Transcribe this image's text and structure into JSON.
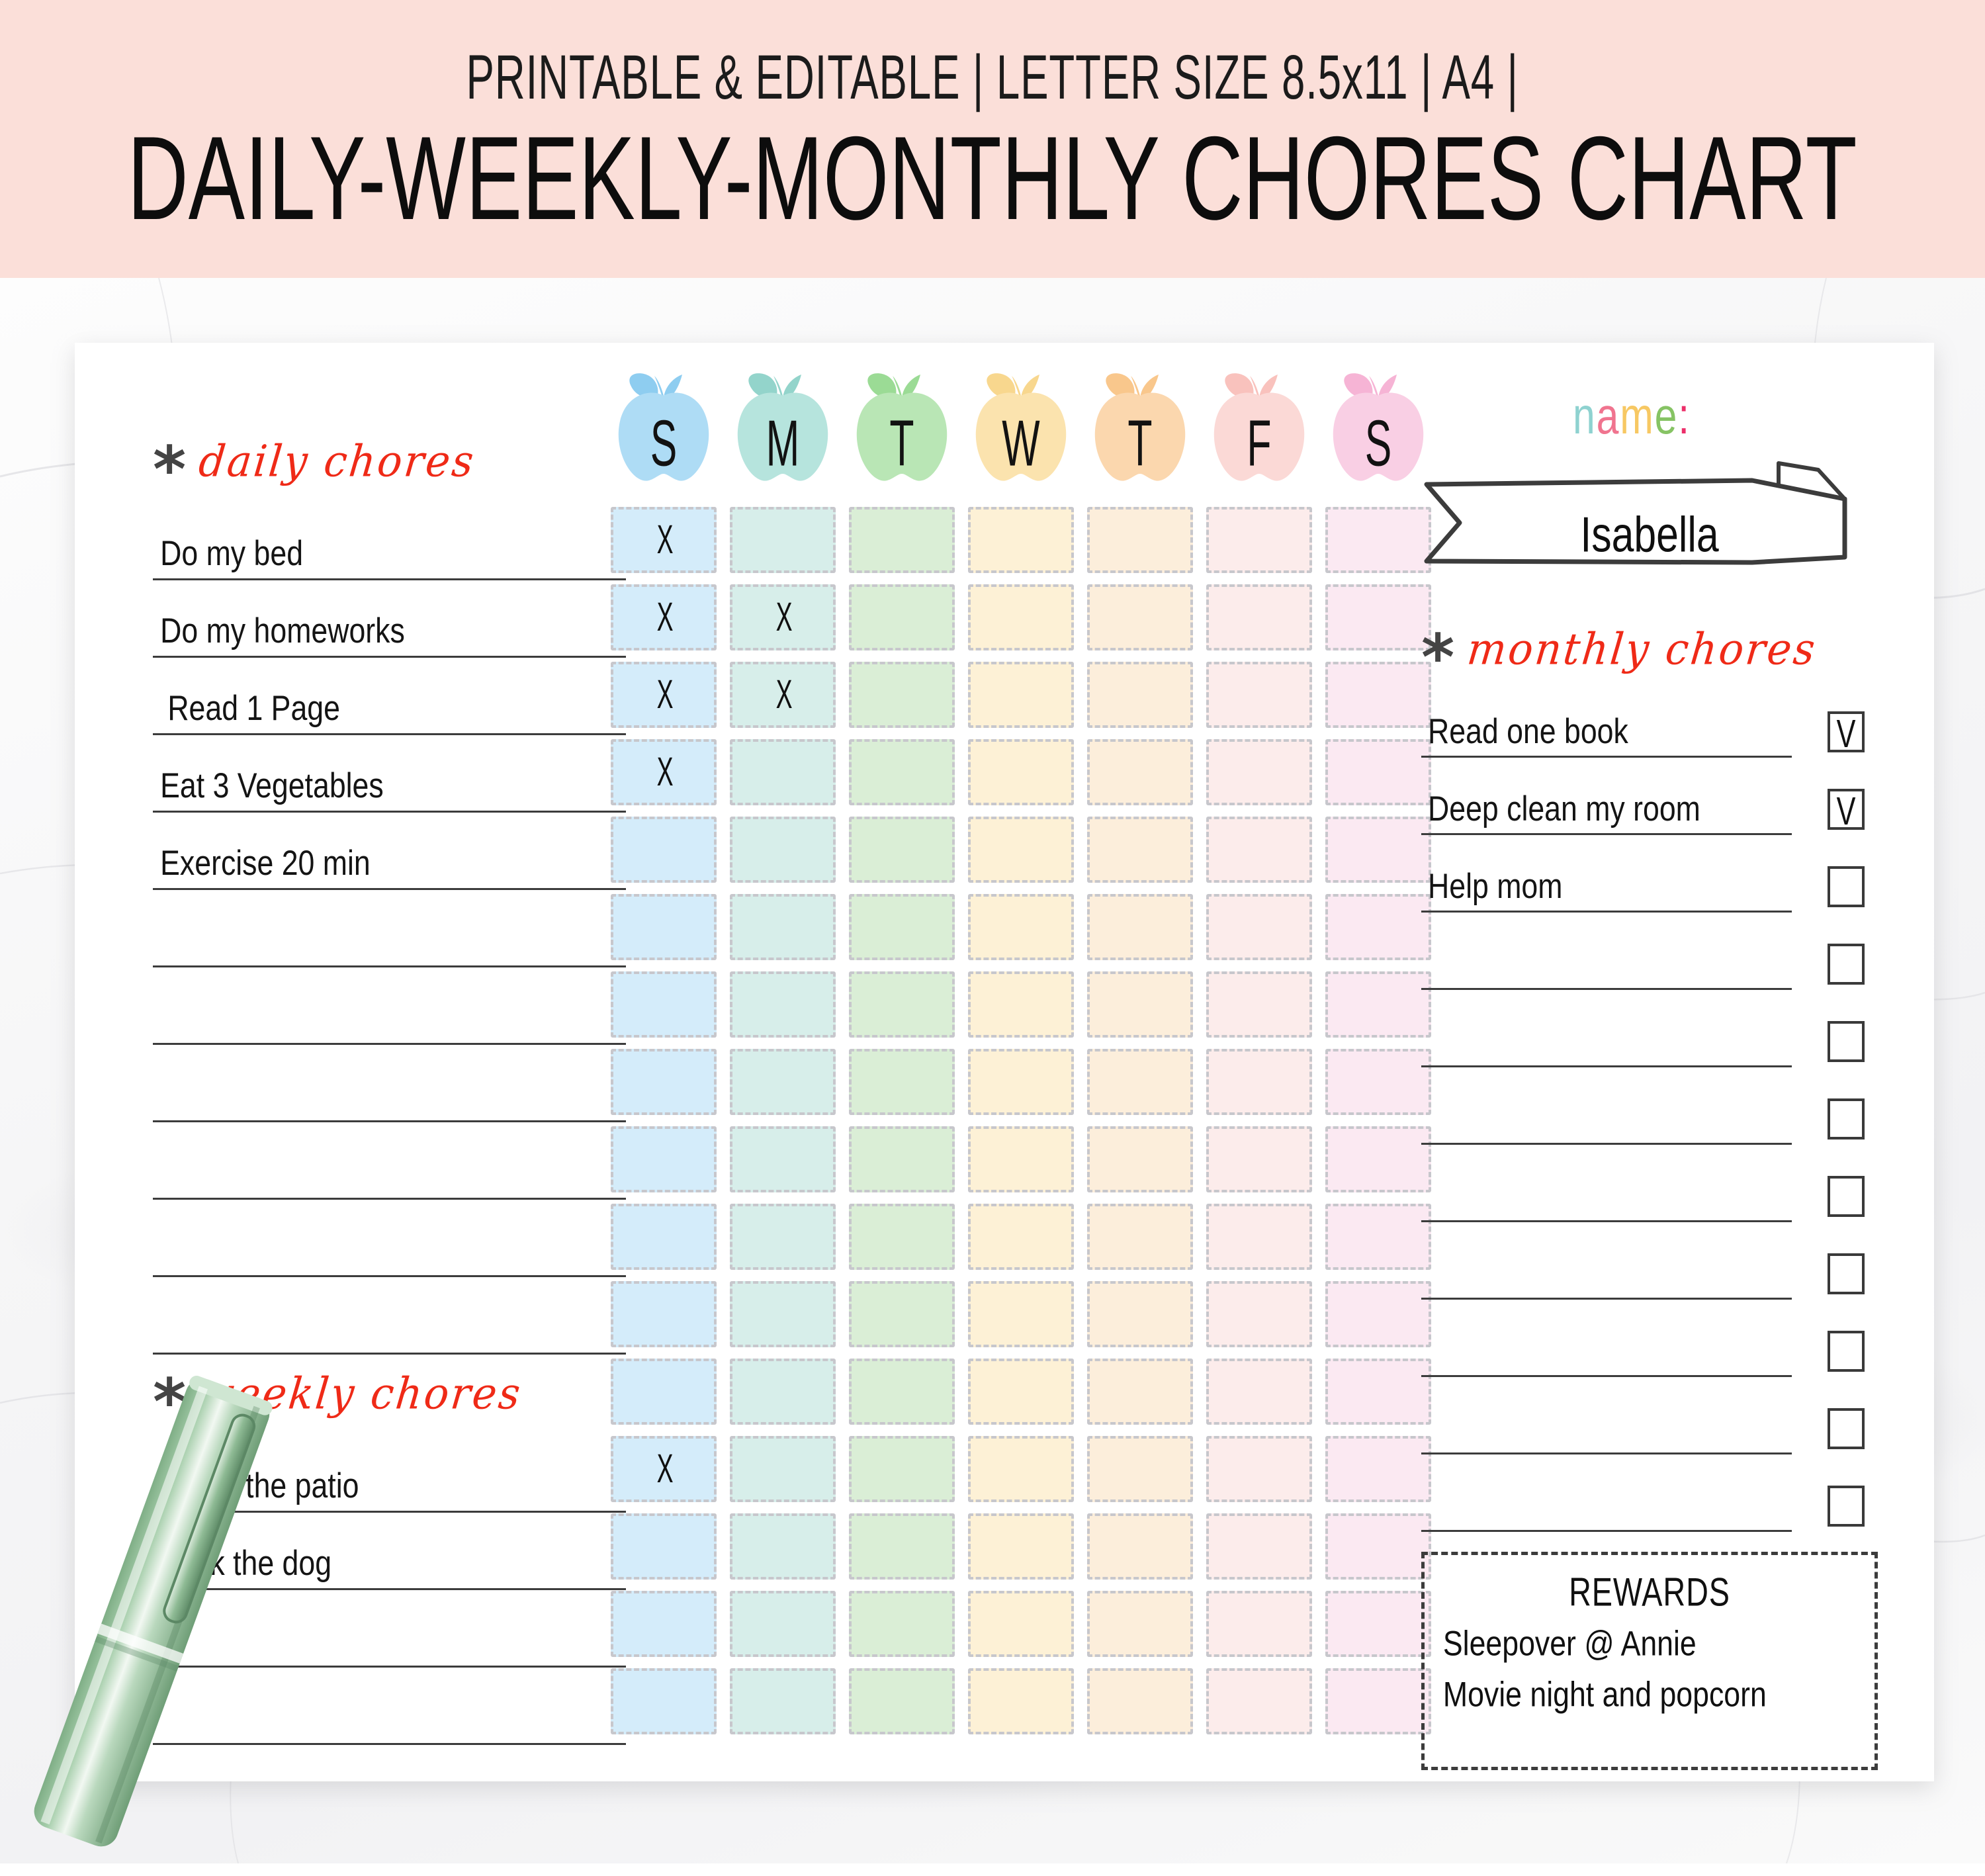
{
  "header": {
    "subtitle": "PRINTABLE & EDITABLE | LETTER SIZE 8.5x11 | A4 |",
    "title": "DAILY-WEEKLY-MONTHLY CHORES CHART",
    "band_color": "#fbdfd9"
  },
  "daily": {
    "asterisk": "*",
    "heading": "daily chores",
    "heading_color": "#ef2a17",
    "items": [
      "Do my bed",
      "Do my homeworks",
      "Read 1 Page",
      "Eat 3 Vegetables",
      "Exercise 20 min",
      "",
      "",
      "",
      "",
      "",
      ""
    ]
  },
  "weekly": {
    "asterisk": "*",
    "heading": "weekly chores",
    "heading_color": "#ef2a17",
    "items": [
      "Brush the patio",
      "Walk the dog",
      "",
      ""
    ]
  },
  "week_header": {
    "days": [
      {
        "letter": "S",
        "color": "#aedcf5",
        "stem_color": "#8ecdf0"
      },
      {
        "letter": "M",
        "color": "#b6e4dd",
        "stem_color": "#93d4cb"
      },
      {
        "letter": "T",
        "color": "#b9e6b5",
        "stem_color": "#9bdb95"
      },
      {
        "letter": "W",
        "color": "#fbe3ae",
        "stem_color": "#f8d78e"
      },
      {
        "letter": "T",
        "color": "#fbd7ae",
        "stem_color": "#f9c78c"
      },
      {
        "letter": "F",
        "color": "#fbd9d6",
        "stem_color": "#f9c2bd"
      },
      {
        "letter": "S",
        "color": "#f9cfe4",
        "stem_color": "#f6b4d5"
      }
    ]
  },
  "grid": {
    "rows": 16,
    "cols": 7,
    "mark": "X",
    "cell_colors": [
      "#d4ecfa",
      "#d7eeea",
      "#daeed6",
      "#fdf1d6",
      "#fceedb",
      "#fceceb",
      "#fbe9f2"
    ],
    "marks": [
      [
        1,
        0,
        0,
        0,
        0,
        0,
        0
      ],
      [
        1,
        1,
        0,
        0,
        0,
        0,
        0
      ],
      [
        1,
        1,
        0,
        0,
        0,
        0,
        0
      ],
      [
        1,
        0,
        0,
        0,
        0,
        0,
        0
      ],
      [
        0,
        0,
        0,
        0,
        0,
        0,
        0
      ],
      [
        0,
        0,
        0,
        0,
        0,
        0,
        0
      ],
      [
        0,
        0,
        0,
        0,
        0,
        0,
        0
      ],
      [
        0,
        0,
        0,
        0,
        0,
        0,
        0
      ],
      [
        0,
        0,
        0,
        0,
        0,
        0,
        0
      ],
      [
        0,
        0,
        0,
        0,
        0,
        0,
        0
      ],
      [
        0,
        0,
        0,
        0,
        0,
        0,
        0
      ],
      [
        0,
        0,
        0,
        0,
        0,
        0,
        0
      ],
      [
        1,
        0,
        0,
        0,
        0,
        0,
        0
      ],
      [
        0,
        0,
        0,
        0,
        0,
        0,
        0
      ],
      [
        0,
        0,
        0,
        0,
        0,
        0,
        0
      ],
      [
        0,
        0,
        0,
        0,
        0,
        0,
        0
      ]
    ]
  },
  "name_block": {
    "label_letters": [
      {
        "ch": "n",
        "color": "#8ed2d0"
      },
      {
        "ch": "a",
        "color": "#f0748f"
      },
      {
        "ch": "m",
        "color": "#f7c863"
      },
      {
        "ch": "e",
        "color": "#86c364"
      },
      {
        "ch": ":",
        "color": "#ec2f6a"
      }
    ],
    "label_plain": "name:",
    "value": "Isabella"
  },
  "monthly": {
    "asterisk": "*",
    "heading": "monthly chores",
    "heading_color": "#ef2a17",
    "check_mark": "V",
    "items": [
      {
        "text": "Read one book",
        "checked": true
      },
      {
        "text": "Deep clean my room",
        "checked": true
      },
      {
        "text": "Help mom",
        "checked": false
      },
      {
        "text": "",
        "checked": false
      },
      {
        "text": "",
        "checked": false
      },
      {
        "text": "",
        "checked": false
      },
      {
        "text": "",
        "checked": false
      },
      {
        "text": "",
        "checked": false
      },
      {
        "text": "",
        "checked": false
      },
      {
        "text": "",
        "checked": false
      },
      {
        "text": "",
        "checked": false
      }
    ]
  },
  "rewards": {
    "title": "REWARDS",
    "lines": [
      "Sleepover @ Annie",
      "Movie night and popcorn"
    ]
  },
  "decor": {
    "pen_color": "#9dc9a3",
    "paper_color": "#ffffff"
  }
}
